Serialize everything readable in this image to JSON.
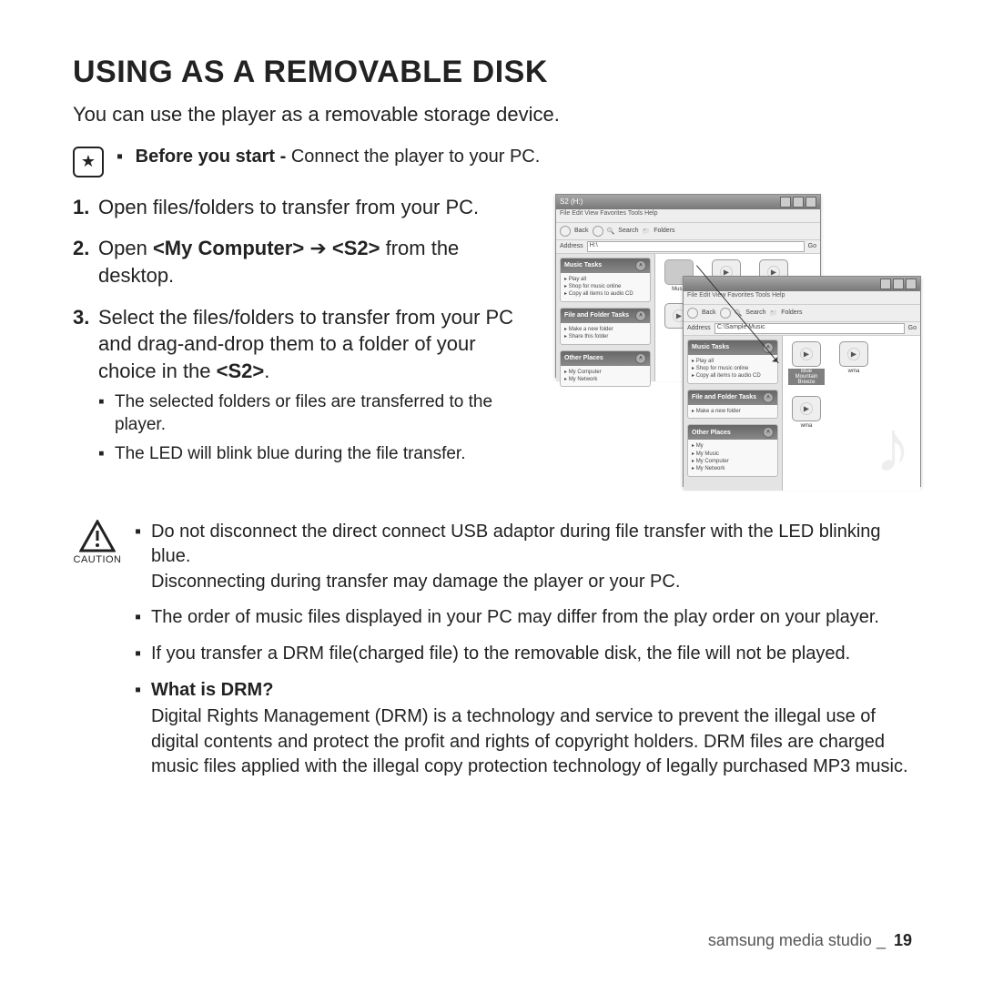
{
  "title": "USING AS A REMOVABLE DISK",
  "intro": "You can use the player as a removable storage device.",
  "note": {
    "lead": "Before you start - ",
    "text": "Connect the player to your PC."
  },
  "steps": [
    {
      "text": "Open files/folders to transfer from your PC."
    },
    {
      "prefix": "Open ",
      "bold": "<My Computer>",
      "arrow": " ➔ ",
      "bold2": "<S2>",
      "suffix": " from the desktop."
    },
    {
      "line1_a": "Select the files/folders to transfer from your PC and drag-and-drop them to a folder of your choice in the ",
      "line1_b": "<S2>",
      "line1_c": ".",
      "sub": [
        "The selected folders or files are transferred to the player.",
        "The LED will blink blue during the file transfer."
      ]
    }
  ],
  "windows": {
    "a": {
      "title": "S2 (H:)",
      "menu": "File  Edit  View  Favorites  Tools  Help",
      "toolbar_back": "Back",
      "toolbar_search": "Search",
      "toolbar_folders": "Folders",
      "address_label": "Address",
      "address_value": "H:\\",
      "groups": {
        "music": {
          "head": "Music Tasks",
          "items": [
            "Play all",
            "Shop for music online",
            "Copy all items to audio CD"
          ]
        },
        "fft": {
          "head": "File and Folder Tasks",
          "items": [
            "Make a new folder",
            "Share this folder"
          ]
        },
        "other": {
          "head": "Other Places",
          "items": [
            "My Computer",
            "My Network"
          ]
        }
      },
      "folder_label": "Music"
    },
    "b": {
      "menu": "File  Edit  View  Favorites  Tools  Help",
      "toolbar_back": "Back",
      "toolbar_search": "Search",
      "toolbar_folders": "Folders",
      "address_label": "Address",
      "address_value": "C:\\Sample Music",
      "groups": {
        "music": {
          "head": "Music Tasks",
          "items": [
            "Play all",
            "Shop for music online",
            "Copy all items to audio CD"
          ]
        },
        "fft": {
          "head": "File and Folder Tasks",
          "items": [
            "Make a new folder"
          ]
        },
        "other": {
          "head": "Other Places",
          "items": [
            "My",
            "My Music",
            "My Computer",
            "My Network"
          ]
        }
      },
      "files": {
        "f1": "Blue Mountain Breeze",
        "f2": "wma",
        "f3": "wma"
      }
    }
  },
  "caution": {
    "label": "CAUTION",
    "items": [
      {
        "line1": "Do not disconnect the direct connect USB adaptor during file transfer with the LED blinking blue.",
        "line2": "Disconnecting during transfer may damage the player or your PC."
      },
      {
        "line1": "The order of music files displayed in your PC may differ from the play order on your player."
      },
      {
        "line1": "If you transfer a DRM file(charged file) to the removable disk, the file will not be played."
      },
      {
        "q": "What is DRM?",
        "body": "Digital Rights Management (DRM) is a technology and service to prevent the illegal use of digital contents and protect the profit and rights of copyright holders. DRM files are charged music files applied with the illegal copy protection technology of legally purchased MP3 music."
      }
    ]
  },
  "footer": {
    "section": "samsung media studio _",
    "page": "19"
  }
}
